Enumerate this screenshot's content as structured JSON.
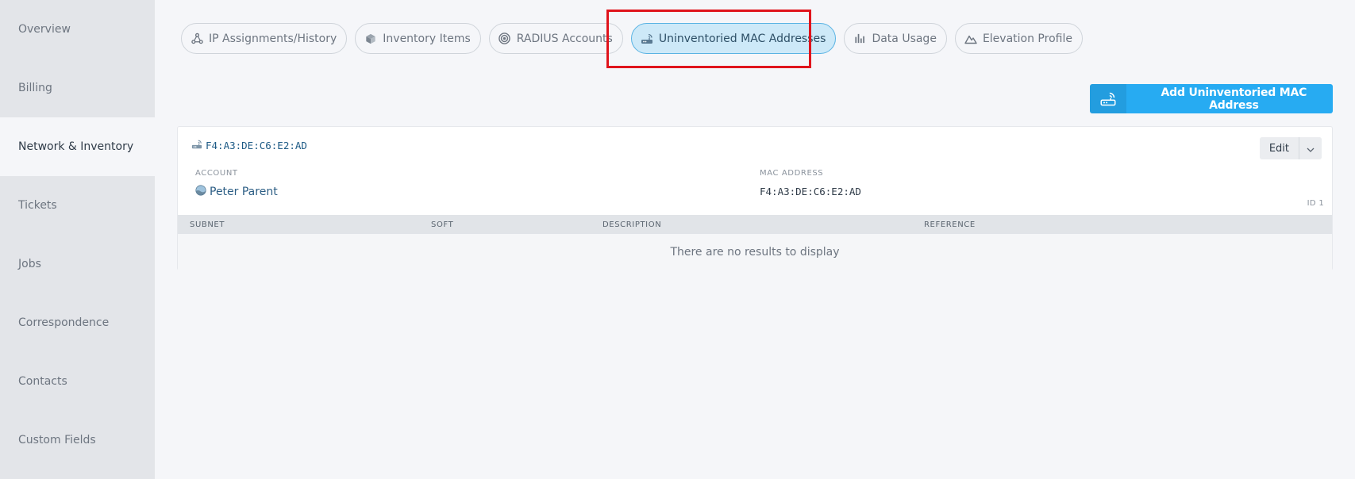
{
  "sidebar": {
    "items": [
      {
        "label": "Overview"
      },
      {
        "label": "Billing"
      },
      {
        "label": "Network & Inventory",
        "active": true
      },
      {
        "label": "Tickets"
      },
      {
        "label": "Jobs"
      },
      {
        "label": "Correspondence"
      },
      {
        "label": "Contacts"
      },
      {
        "label": "Custom Fields"
      }
    ]
  },
  "tabs": [
    {
      "label": "IP Assignments/History",
      "icon": "network-icon"
    },
    {
      "label": "Inventory Items",
      "icon": "cube-icon"
    },
    {
      "label": "RADIUS Accounts",
      "icon": "radius-icon"
    },
    {
      "label": "Uninventoried MAC Addresses",
      "icon": "router-icon",
      "active": true
    },
    {
      "label": "Data Usage",
      "icon": "bar-chart-icon"
    },
    {
      "label": "Elevation Profile",
      "icon": "mountain-icon"
    }
  ],
  "actions": {
    "add_label": "Add Uninventoried MAC Address"
  },
  "record": {
    "title": "F4:A3:DE:C6:E2:AD",
    "edit_label": "Edit",
    "account_label": "ACCOUNT",
    "account_value": "Peter Parent",
    "mac_label": "MAC ADDRESS",
    "mac_value": "F4:A3:DE:C6:E2:AD",
    "id_label": "ID 1"
  },
  "table": {
    "columns": [
      "SUBNET",
      "SOFT",
      "DESCRIPTION",
      "REFERENCE"
    ],
    "empty_message": "There are no results to display"
  },
  "colors": {
    "accent": "#27abf2",
    "active_tab_bg": "#cde9f8",
    "highlight": "#e0141c"
  }
}
